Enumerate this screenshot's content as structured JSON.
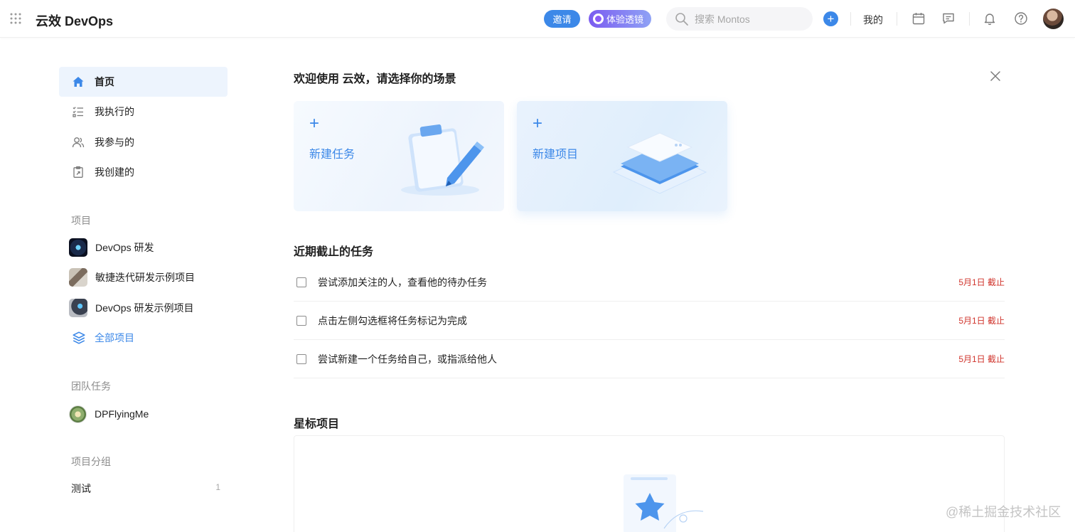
{
  "header": {
    "brand": "云效 DevOps",
    "invite_label": "邀请",
    "trial_label": "体验透镜",
    "search_placeholder": "搜索 Montos",
    "mine_label": "我的"
  },
  "sidebar": {
    "nav": [
      {
        "label": "首页",
        "icon": "home-icon",
        "active": true
      },
      {
        "label": "我执行的",
        "icon": "checklist-icon"
      },
      {
        "label": "我参与的",
        "icon": "users-icon"
      },
      {
        "label": "我创建的",
        "icon": "clipboard-icon"
      }
    ],
    "projects_title": "项目",
    "projects": [
      {
        "label": "DevOps 研发"
      },
      {
        "label": "敏捷迭代研发示例项目"
      },
      {
        "label": "DevOps 研发示例项目"
      }
    ],
    "all_projects_label": "全部项目",
    "team_title": "团队任务",
    "team_member": "DPFlyingMe",
    "group_title": "项目分组",
    "groups": [
      {
        "label": "测试",
        "count": "1"
      }
    ]
  },
  "main": {
    "welcome_title": "欢迎使用 云效，请选择你的场景",
    "cards": [
      {
        "label": "新建任务"
      },
      {
        "label": "新建项目"
      }
    ],
    "due_title": "近期截止的任务",
    "tasks": [
      {
        "text": "尝试添加关注的人，查看他的待办任务",
        "due": "5月1日 截止"
      },
      {
        "text": "点击左侧勾选框将任务标记为完成",
        "due": "5月1日 截止"
      },
      {
        "text": "尝试新建一个任务给自己，或指派给他人",
        "due": "5月1日 截止"
      }
    ],
    "starred_title": "星标项目"
  },
  "watermark": "@稀土掘金技术社区",
  "colors": {
    "accent": "#3c88e8",
    "due": "#d0342c"
  }
}
